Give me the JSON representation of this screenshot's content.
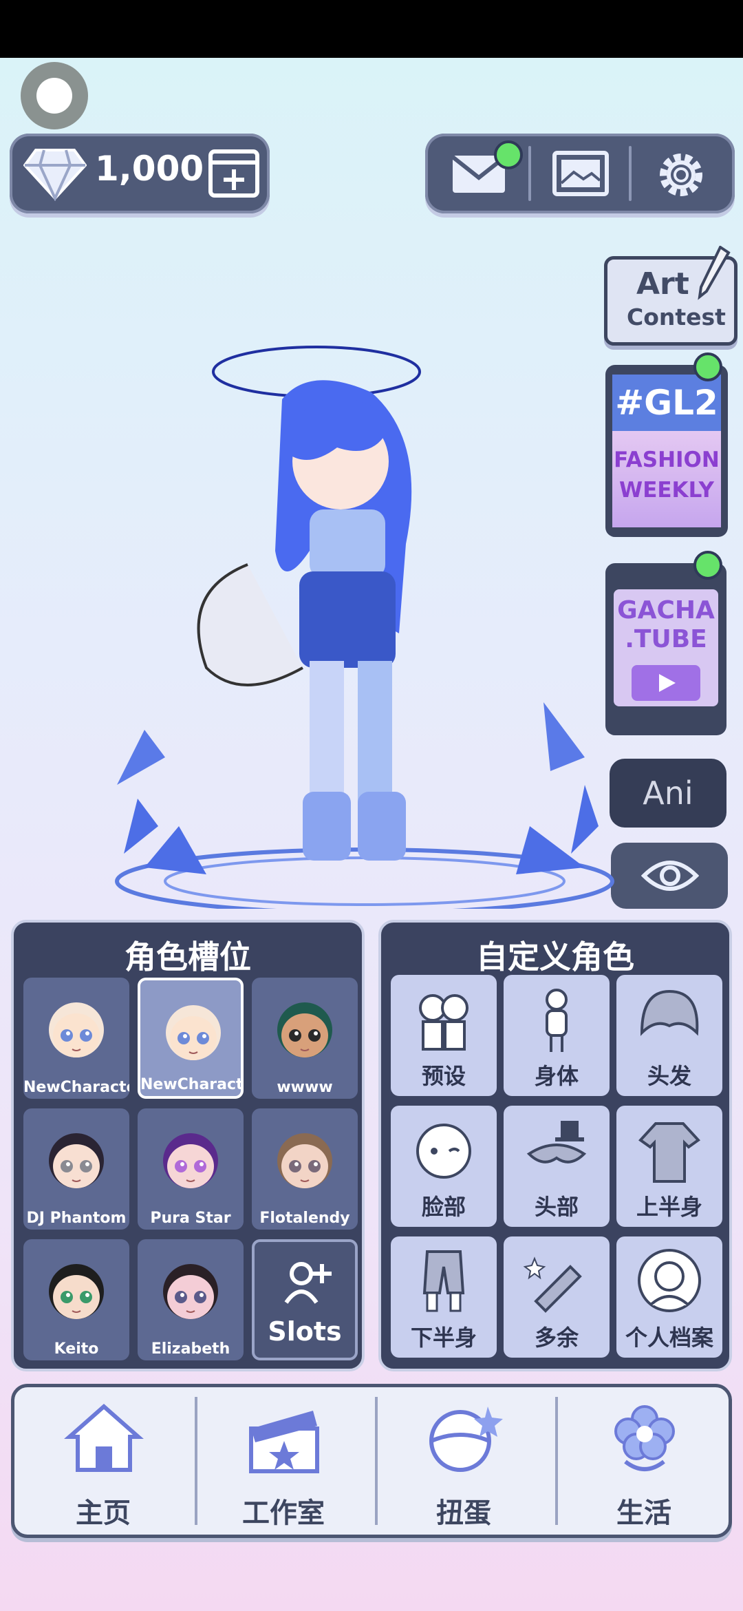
{
  "currency": {
    "gems": "1,000"
  },
  "side": {
    "art_contest": [
      "Art",
      "Contest"
    ],
    "gl2": {
      "tag": "#GL2",
      "lines": [
        "FASHION",
        "WEEKLY"
      ]
    },
    "gachatube": [
      "GACHA",
      ".TUBE"
    ],
    "ani": "Ani"
  },
  "slots": {
    "title": "角色槽位",
    "items": [
      {
        "name": "NewCharacter",
        "hair": "#f6e6d8",
        "skin": "#fbe3cf",
        "eyes": "#6d8ad8"
      },
      {
        "name": "NewCharacte",
        "hair": "#f6e6d8",
        "skin": "#fbe3cf",
        "eyes": "#6d8ad8"
      },
      {
        "name": "wwww",
        "hair": "#1f5a4e",
        "skin": "#d8a07a",
        "eyes": "#2a2a2a"
      },
      {
        "name": "DJ Phantom",
        "hair": "#2a2433",
        "skin": "#f8dfd2",
        "eyes": "#8a8a92"
      },
      {
        "name": "Pura Star",
        "hair": "#5a2a8c",
        "skin": "#f6d6d6",
        "eyes": "#b06ad8"
      },
      {
        "name": "Flotalendy",
        "hair": "#8a6a52",
        "skin": "#f2d4c6",
        "eyes": "#7a6a7a"
      },
      {
        "name": "Keito",
        "hair": "#1e1e1e",
        "skin": "#f6dccb",
        "eyes": "#3a9a6a"
      },
      {
        "name": "Elizabeth",
        "hair": "#2a2026",
        "skin": "#f4cdd6",
        "eyes": "#5a5a8a"
      }
    ],
    "add_label": "Slots"
  },
  "customize": {
    "title": "自定义角色",
    "items": [
      "预设",
      "身体",
      "头发",
      "脸部",
      "头部",
      "上半身",
      "下半身",
      "多余",
      "个人档案"
    ]
  },
  "nav": [
    "主页",
    "工作室",
    "扭蛋",
    "生活"
  ]
}
